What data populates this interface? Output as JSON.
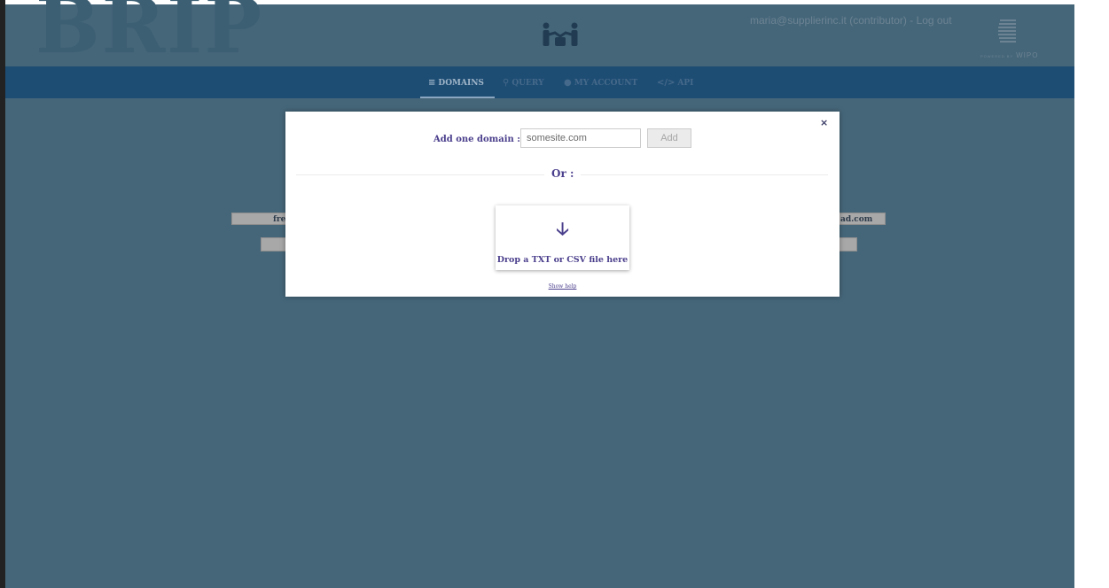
{
  "header": {
    "brand": "BRIP",
    "user_info": "maria@supplierinc.it (contributor) - Log out",
    "wipo_small": "POWERED BY",
    "wipo_label": "WIPO"
  },
  "nav": {
    "items": [
      {
        "icon": "≡",
        "label": "DOMAINS"
      },
      {
        "icon": "⚲",
        "label": "QUERY"
      },
      {
        "icon": "●",
        "label": "MY ACCOUNT"
      },
      {
        "icon": "</>",
        "label": "API"
      }
    ]
  },
  "background": {
    "chip_left": "fre",
    "chip_right": "ad.com"
  },
  "modal": {
    "add_label": "Add one domain :",
    "add_placeholder": "somesite.com",
    "add_button": "Add",
    "or_label": "Or :",
    "drop_icon": "🡣",
    "drop_text": "Drop a TXT or CSV file here",
    "show_help": "Show help",
    "close_symbol": "×"
  },
  "colors": {
    "page_dim": "#456679",
    "nav_bar": "#1e4d74",
    "accent_text": "#4a3f8c"
  }
}
